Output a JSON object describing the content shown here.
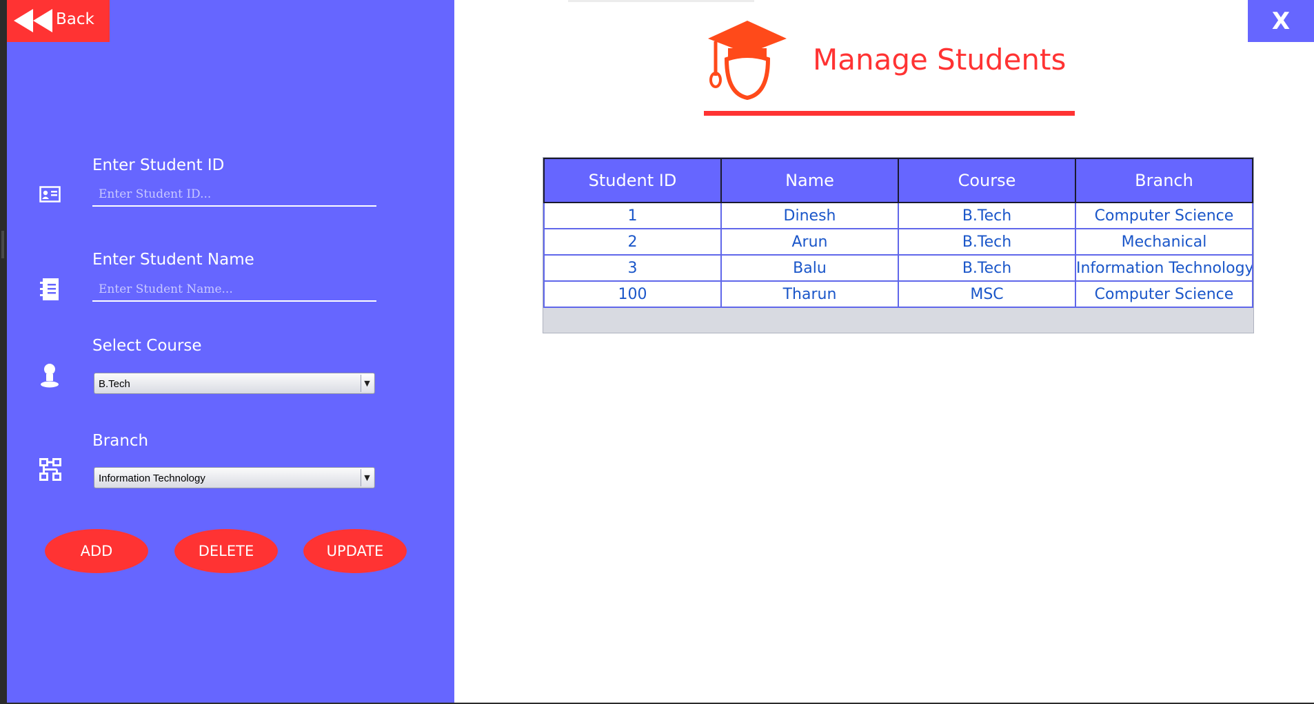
{
  "sidebar": {
    "back_label": "Back",
    "student_id": {
      "label": "Enter Student ID",
      "placeholder": "Enter Student ID...",
      "value": ""
    },
    "student_name": {
      "label": "Enter Student Name",
      "placeholder": "Enter Student Name...",
      "value": ""
    },
    "course": {
      "label": "Select Course",
      "selected": "B.Tech"
    },
    "branch": {
      "label": "Branch",
      "selected": "Information Technology"
    },
    "buttons": {
      "add": "ADD",
      "delete": "DELETE",
      "update": "UPDATE"
    }
  },
  "header": {
    "title": "Manage Students",
    "close_label": "X"
  },
  "table": {
    "columns": [
      "Student ID",
      "Name",
      "Course",
      "Branch"
    ],
    "rows": [
      [
        "1",
        "Dinesh",
        "B.Tech",
        "Computer Science"
      ],
      [
        "2",
        "Arun",
        "B.Tech",
        "Mechanical"
      ],
      [
        "3",
        "Balu",
        "B.Tech",
        "Information Technology"
      ],
      [
        "100",
        "Tharun",
        "MSC",
        "Computer Science"
      ]
    ]
  },
  "icons": {
    "back": "rewind-icon",
    "student_id": "id-card-icon",
    "student_name": "notebook-icon",
    "course": "person-icon",
    "branch": "hierarchy-icon",
    "logo": "graduate-cap-icon"
  },
  "colors": {
    "sidebar_bg": "#6666ff",
    "accent_red": "#ff3333",
    "table_text": "#1a56c9",
    "main_bg": "#ffffff"
  }
}
